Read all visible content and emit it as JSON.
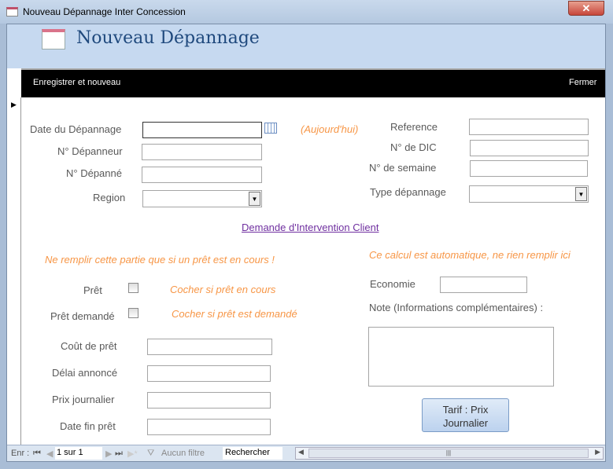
{
  "window": {
    "title": "Nouveau Dépannage Inter Concession",
    "close": "✕"
  },
  "header": {
    "title": "Nouveau Dépannage"
  },
  "toolbar": {
    "save_new": "Enregistrer et nouveau",
    "close": "Fermer"
  },
  "form": {
    "date_label": "Date du Dépannage",
    "today_hint": "(Aujourd'hui)",
    "depanneur_label": "N° Dépanneur",
    "depanne_label": "N° Dépanné",
    "region_label": "Region",
    "reference_label": "Reference",
    "dic_label": "N° de DIC",
    "semaine_label": "N° de semaine",
    "type_label": "Type dépannage",
    "link": "Demande d'Intervention Client",
    "pret_note": "Ne remplir cette partie que si un prêt est en cours !",
    "auto_note": "Ce calcul est automatique, ne rien remplir ici",
    "pret_label": "Prêt",
    "pret_hint": "Cocher si prêt en cours",
    "pret_demande_label": "Prêt demandé",
    "pret_demande_hint": "Cocher si prêt est demandé",
    "cout_label": "Coût de prêt",
    "delai_label": "Délai annoncé",
    "prix_label": "Prix journalier",
    "datefin_label": "Date fin prêt",
    "economie_label": "Economie",
    "note_label": "Note (Informations complémentaires) :",
    "tarif_button": "Tarif : Prix Journalier"
  },
  "nav": {
    "record_label": "Enr :",
    "record_value": "1 sur 1",
    "filter": "Aucun filtre",
    "search": "Rechercher"
  }
}
